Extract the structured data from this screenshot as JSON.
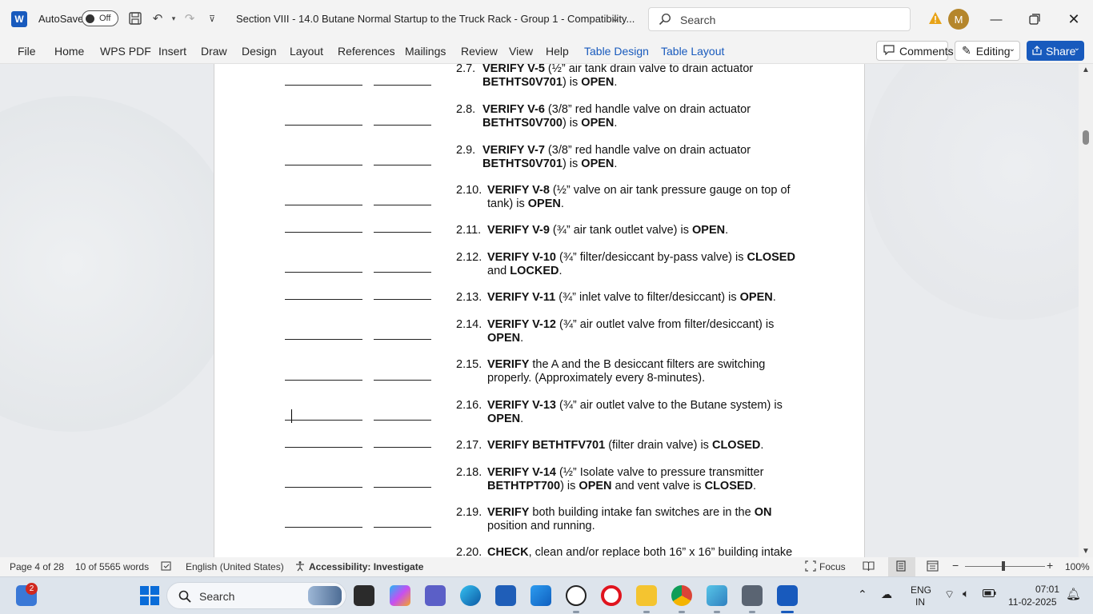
{
  "titlebar": {
    "autosave_label": "AutoSave",
    "autosave_state": "Off",
    "doc_title": "Section VIII - 14.0 Butane Normal Startup to the Truck Rack - Group 1  -  Compatibility...",
    "search_placeholder": "Search",
    "user_initial": "M"
  },
  "menu": {
    "items": [
      "File",
      "Home",
      "WPS PDF",
      "Insert",
      "Draw",
      "Design",
      "Layout",
      "References",
      "Mailings",
      "Review",
      "View",
      "Help",
      "Table Design",
      "Table Layout"
    ],
    "comments_label": "Comments",
    "editing_label": "Editing",
    "share_label": "Share"
  },
  "document": {
    "steps": [
      {
        "num": "2.7.",
        "l1": [
          [
            "b",
            "VERIFY V-5"
          ],
          [
            "n",
            " (½” air tank drain valve to drain actuator"
          ]
        ],
        "l2": [
          [
            "b",
            "BETHTS0V701"
          ],
          [
            "n",
            ") is "
          ],
          [
            "b",
            "OPEN"
          ],
          [
            "n",
            "."
          ]
        ]
      },
      {
        "num": "2.8.",
        "l1": [
          [
            "b",
            "VERIFY V-6"
          ],
          [
            "n",
            " (3/8” red handle valve on drain actuator"
          ]
        ],
        "l2": [
          [
            "b",
            "BETHTS0V700"
          ],
          [
            "n",
            ") is "
          ],
          [
            "b",
            "OPEN"
          ],
          [
            "n",
            "."
          ]
        ]
      },
      {
        "num": "2.9.",
        "l1": [
          [
            "b",
            "VERIFY V-7"
          ],
          [
            "n",
            " (3/8” red handle valve on drain actuator"
          ]
        ],
        "l2": [
          [
            "b",
            "BETHTS0V701"
          ],
          [
            "n",
            ") is "
          ],
          [
            "b",
            "OPEN"
          ],
          [
            "n",
            "."
          ]
        ]
      },
      {
        "num": "2.10.",
        "l1": [
          [
            "b",
            "VERIFY V-8"
          ],
          [
            "n",
            " (½” valve on air tank pressure gauge on top of"
          ]
        ],
        "l2": [
          [
            "n",
            "tank) is "
          ],
          [
            "b",
            "OPEN"
          ],
          [
            "n",
            "."
          ]
        ]
      },
      {
        "num": "2.11.",
        "l1": [
          [
            "b",
            "VERIFY V-9"
          ],
          [
            "n",
            " (¾” air tank outlet valve) is "
          ],
          [
            "b",
            "OPEN"
          ],
          [
            "n",
            "."
          ]
        ],
        "l2": []
      },
      {
        "num": "2.12.",
        "l1": [
          [
            "b",
            "VERIFY V-10"
          ],
          [
            "n",
            " (¾” filter/desiccant by-pass valve) is "
          ],
          [
            "b",
            "CLOSED"
          ]
        ],
        "l2": [
          [
            "n",
            "and "
          ],
          [
            "b",
            "LOCKED"
          ],
          [
            "n",
            "."
          ]
        ]
      },
      {
        "num": "2.13.",
        "l1": [
          [
            "b",
            "VERIFY V-11"
          ],
          [
            "n",
            " (¾” inlet valve to filter/desiccant) is "
          ],
          [
            "b",
            "OPEN"
          ],
          [
            "n",
            "."
          ]
        ],
        "l2": []
      },
      {
        "num": "2.14.",
        "l1": [
          [
            "b",
            "VERIFY V-12"
          ],
          [
            "n",
            " (¾” air outlet valve from filter/desiccant) is"
          ]
        ],
        "l2": [
          [
            "b",
            "OPEN"
          ],
          [
            "n",
            "."
          ]
        ]
      },
      {
        "num": "2.15.",
        "l1": [
          [
            "b",
            "VERIFY"
          ],
          [
            "n",
            " the A and the B desiccant filters are switching"
          ]
        ],
        "l2": [
          [
            "n",
            "properly. (Approximately every 8-minutes)."
          ]
        ]
      },
      {
        "num": "2.16.",
        "l1": [
          [
            "b",
            "VERIFY V-13"
          ],
          [
            "n",
            " (¾” air outlet valve to the Butane system) is"
          ]
        ],
        "l2": [
          [
            "b",
            "OPEN"
          ],
          [
            "n",
            "."
          ]
        ]
      },
      {
        "num": "2.17.",
        "l1": [
          [
            "b",
            "VERIFY BETHTFV701"
          ],
          [
            "n",
            " (filter drain valve) is "
          ],
          [
            "b",
            "CLOSED"
          ],
          [
            "n",
            "."
          ]
        ],
        "l2": []
      },
      {
        "num": "2.18.",
        "l1": [
          [
            "b",
            "VERIFY V-14"
          ],
          [
            "n",
            " (½” Isolate valve to pressure transmitter"
          ]
        ],
        "l2": [
          [
            "b",
            "BETHTPT700"
          ],
          [
            "n",
            ") is "
          ],
          [
            "b",
            "OPEN"
          ],
          [
            "n",
            " and vent valve is "
          ],
          [
            "b",
            "CLOSED"
          ],
          [
            "n",
            "."
          ]
        ]
      },
      {
        "num": "2.19.",
        "l1": [
          [
            "b",
            "VERIFY"
          ],
          [
            "n",
            " both building intake fan switches are in the "
          ],
          [
            "b",
            "ON"
          ]
        ],
        "l2": [
          [
            "n",
            "position and running."
          ]
        ]
      },
      {
        "num": "2.20.",
        "l1": [
          [
            "b",
            "CHECK"
          ],
          [
            "n",
            ", clean and/or replace both 16” x 16” building intake"
          ]
        ],
        "l2": []
      }
    ]
  },
  "statusbar": {
    "page": "Page 4 of 28",
    "words": "10 of 5565 words",
    "language": "English (United States)",
    "accessibility": "Accessibility: Investigate",
    "focus": "Focus",
    "zoom": "100%",
    "zoom_fraction": 0.5
  },
  "taskbar": {
    "search_label": "Search",
    "notification_count": "2",
    "lang_line1": "ENG",
    "lang_line2": "IN",
    "time": "07:01",
    "date": "11-02-2025"
  },
  "colors": {
    "word_blue": "#185abd",
    "avatar": "#b5862b",
    "warning": "#e8a317"
  }
}
